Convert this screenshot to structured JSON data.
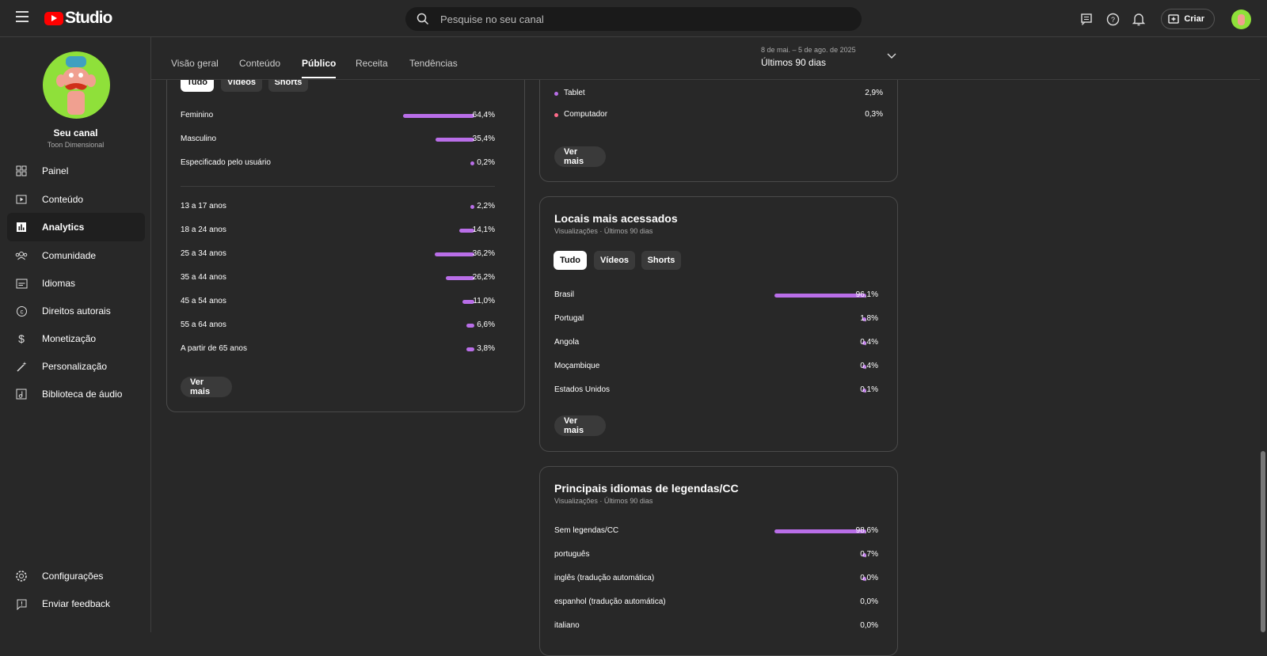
{
  "header": {
    "logo_text": "Studio",
    "search_placeholder": "Pesquise no seu canal",
    "create_label": "Criar"
  },
  "sidebar": {
    "channel_name": "Seu canal",
    "channel_sub": "Toon Dimensional",
    "items": [
      {
        "label": "Painel",
        "icon": "dashboard-icon"
      },
      {
        "label": "Conteúdo",
        "icon": "content-icon"
      },
      {
        "label": "Analytics",
        "icon": "analytics-icon"
      },
      {
        "label": "Comunidade",
        "icon": "community-icon"
      },
      {
        "label": "Idiomas",
        "icon": "subtitles-icon"
      },
      {
        "label": "Direitos autorais",
        "icon": "copyright-icon"
      },
      {
        "label": "Monetização",
        "icon": "dollar-icon"
      },
      {
        "label": "Personalização",
        "icon": "magic-wand-icon"
      },
      {
        "label": "Biblioteca de áudio",
        "icon": "audio-library-icon"
      }
    ],
    "settings_label": "Configurações",
    "feedback_label": "Enviar feedback"
  },
  "tabs": [
    "Visão geral",
    "Conteúdo",
    "Público",
    "Receita",
    "Tendências"
  ],
  "active_tab": "Público",
  "date_range": {
    "range": "8 de mai. – 5 de ago. de 2025",
    "label": "Últimos 90 dias"
  },
  "filters": [
    "Tudo",
    "Vídeos",
    "Shorts"
  ],
  "gender_age_card": {
    "gender": [
      {
        "label": "Feminino",
        "value": 64.4,
        "pct": "64,4%"
      },
      {
        "label": "Masculino",
        "value": 35.4,
        "pct": "35,4%"
      },
      {
        "label": "Especificado pelo usuário",
        "value": 0.2,
        "pct": "0,2%"
      }
    ],
    "age": [
      {
        "label": "13 a 17 anos",
        "value": 2.2,
        "pct": "2,2%"
      },
      {
        "label": "18 a 24 anos",
        "value": 14.1,
        "pct": "14,1%"
      },
      {
        "label": "25 a 34 anos",
        "value": 36.2,
        "pct": "36,2%"
      },
      {
        "label": "35 a 44 anos",
        "value": 26.2,
        "pct": "26,2%"
      },
      {
        "label": "45 a 54 anos",
        "value": 11.0,
        "pct": "11,0%"
      },
      {
        "label": "55 a 64 anos",
        "value": 6.6,
        "pct": "6,6%"
      },
      {
        "label": "A partir de 65 anos",
        "value": 3.8,
        "pct": "3,8%"
      }
    ],
    "more_label": "Ver mais"
  },
  "device_card": {
    "rows": [
      {
        "label": "Tablet",
        "pct": "2,9%",
        "color": "#b96ee8"
      },
      {
        "label": "Computador",
        "pct": "0,3%",
        "color": "#ff6b8a"
      }
    ],
    "more_label": "Ver mais"
  },
  "geo_card": {
    "title": "Locais mais acessados",
    "subtitle": "Visualizações · Últimos 90 dias",
    "rows": [
      {
        "label": "Brasil",
        "value": 96.1,
        "pct": "96,1%"
      },
      {
        "label": "Portugal",
        "value": 1.8,
        "pct": "1,8%"
      },
      {
        "label": "Angola",
        "value": 0.4,
        "pct": "0,4%"
      },
      {
        "label": "Moçambique",
        "value": 0.4,
        "pct": "0,4%"
      },
      {
        "label": "Estados Unidos",
        "value": 0.1,
        "pct": "0,1%"
      }
    ],
    "more_label": "Ver mais"
  },
  "lang_card": {
    "title": "Principais idiomas de legendas/CC",
    "subtitle": "Visualizações · Últimos 90 dias",
    "rows": [
      {
        "label": "Sem legendas/CC",
        "value": 98.6,
        "pct": "98,6%",
        "mark": "bar"
      },
      {
        "label": "português",
        "value": 0.7,
        "pct": "0,7%",
        "mark": "dot"
      },
      {
        "label": "inglês (tradução automática)",
        "value": 0.0,
        "pct": "0,0%",
        "mark": "dot"
      },
      {
        "label": "espanhol (tradução automática)",
        "value": 0.0,
        "pct": "0,0%",
        "mark": "none"
      },
      {
        "label": "italiano",
        "value": 0.0,
        "pct": "0,0%",
        "mark": "none"
      }
    ]
  },
  "colors": {
    "bar": "#b96ee8",
    "accent_red": "#ff0000",
    "avatar_green": "#8fe03a"
  }
}
